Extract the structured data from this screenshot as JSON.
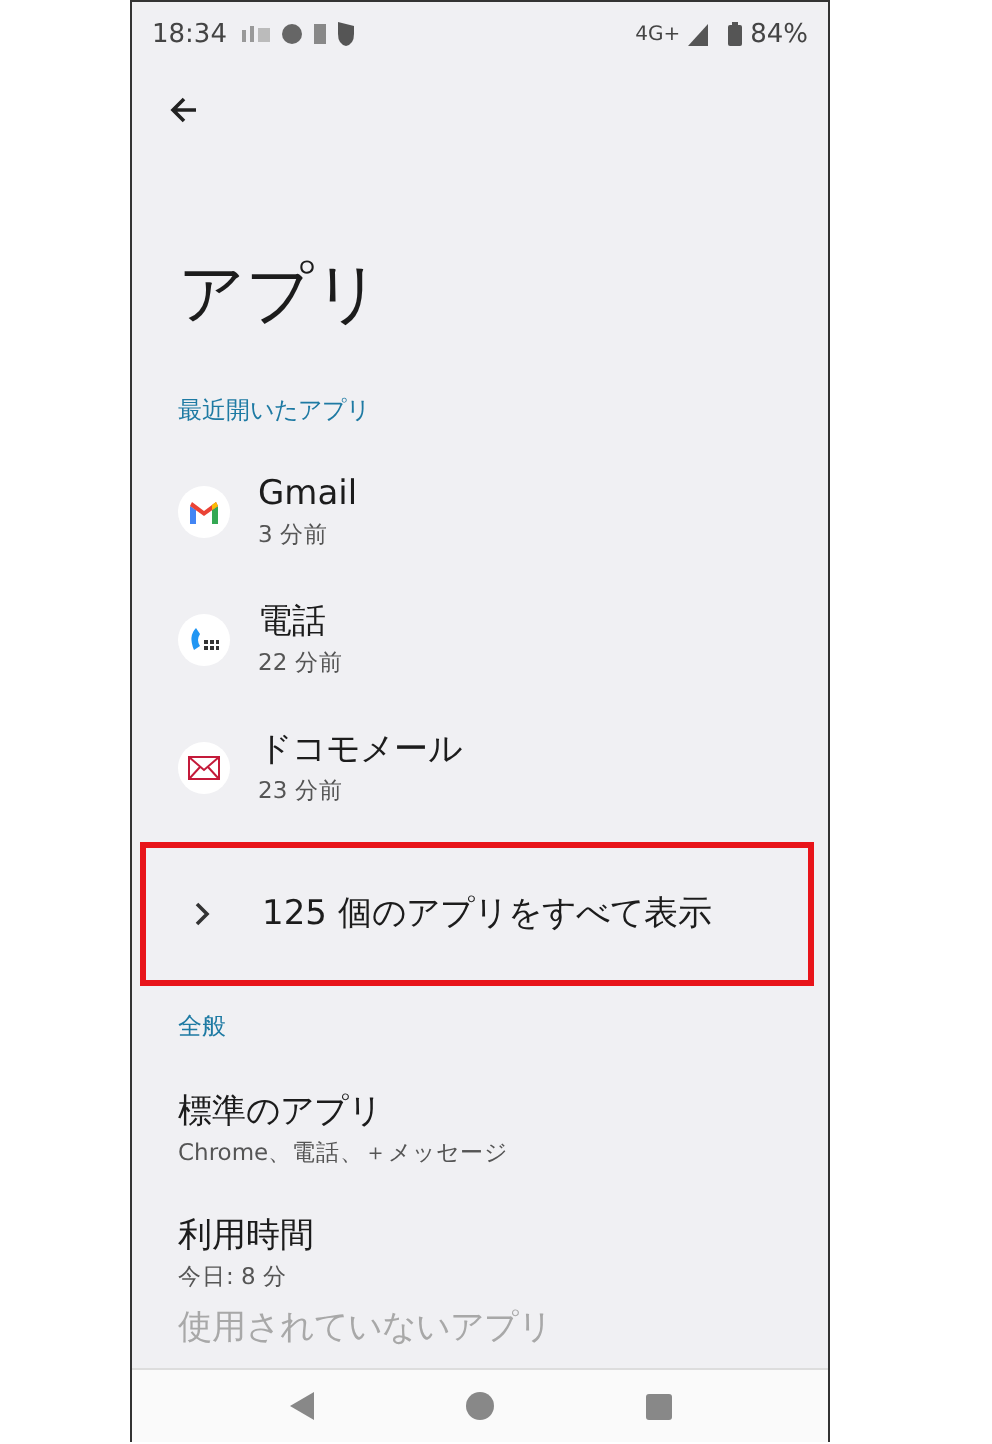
{
  "status_bar": {
    "time": "18:34",
    "network": "4G+",
    "battery": "84%"
  },
  "title": "アプリ",
  "sections": [
    {
      "header": "最近開いたアプリ",
      "items": [
        {
          "kind": "app",
          "title": "Gmail",
          "subtitle": "3 分前"
        },
        {
          "kind": "app",
          "title": "電話",
          "subtitle": "22 分前"
        },
        {
          "kind": "app",
          "title": "ドコモメール",
          "subtitle": "23 分前"
        },
        {
          "kind": "expand",
          "title": "125 個のアプリをすべて表示",
          "highlighted": true
        }
      ]
    },
    {
      "header": "全般",
      "items": [
        {
          "kind": "setting",
          "title": "標準のアプリ",
          "subtitle": "Chrome、電話、＋メッセージ"
        },
        {
          "kind": "setting",
          "title": "利用時間",
          "subtitle": "今日: 8 分"
        },
        {
          "kind": "setting",
          "title": "使用されていないアプリ"
        }
      ]
    }
  ]
}
